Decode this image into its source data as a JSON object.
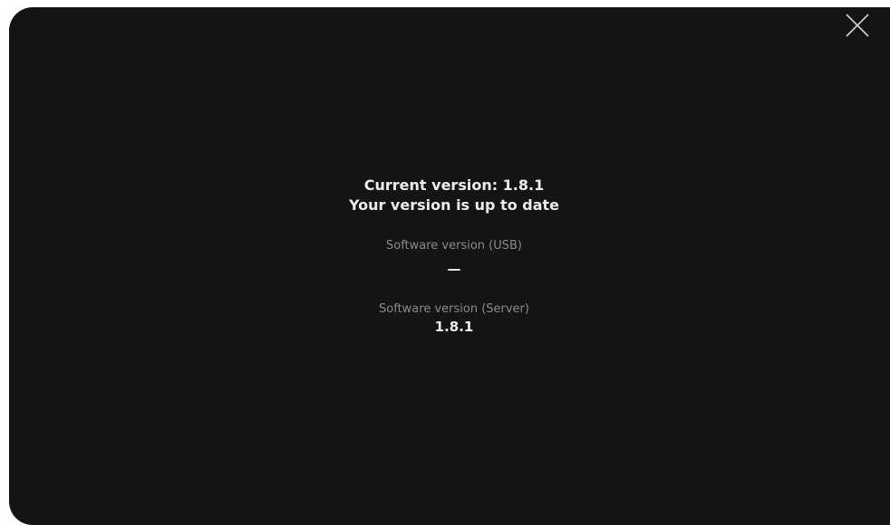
{
  "dialog": {
    "close_icon": "close-icon",
    "current_version_text": "Current version: 1.8.1",
    "up_to_date_text": "Your version is up to date",
    "usb": {
      "label": "Software version (USB)",
      "value": "—"
    },
    "server": {
      "label": "Software version (Server)",
      "value": "1.8.1"
    }
  },
  "colors": {
    "background": "#141414",
    "primary_text": "#ececec",
    "secondary_text": "#8a8a8a"
  }
}
